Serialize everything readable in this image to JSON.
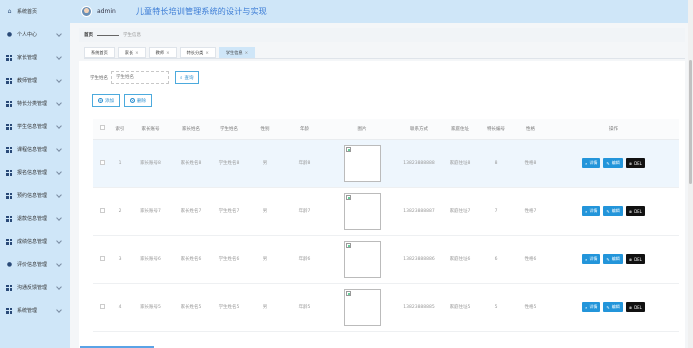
{
  "header": {
    "username": "admin",
    "app_title": "儿童特长培训管理系统的设计与实现"
  },
  "sidebar": {
    "items": [
      {
        "label": "系统首页",
        "icon": "home-icon"
      },
      {
        "label": "个人中心",
        "icon": "user-icon"
      },
      {
        "label": "家长管理",
        "icon": "grid-icon"
      },
      {
        "label": "教师管理",
        "icon": "grid-icon"
      },
      {
        "label": "特长分类管理",
        "icon": "grid-icon"
      },
      {
        "label": "学生信息管理",
        "icon": "grid-icon"
      },
      {
        "label": "课程信息管理",
        "icon": "grid-icon"
      },
      {
        "label": "报名信息管理",
        "icon": "grid-icon"
      },
      {
        "label": "预约信息管理",
        "icon": "grid-icon"
      },
      {
        "label": "退款信息管理",
        "icon": "grid-icon"
      },
      {
        "label": "成绩信息管理",
        "icon": "grid-icon"
      },
      {
        "label": "评价信息管理",
        "icon": "user-icon"
      },
      {
        "label": "沟通反馈管理",
        "icon": "grid-icon"
      },
      {
        "label": "系统管理",
        "icon": "grid-icon"
      }
    ]
  },
  "breadcrumb": {
    "home": "首页",
    "current": "学生信息"
  },
  "tabs": [
    {
      "label": "系统首页",
      "closable": false
    },
    {
      "label": "家长",
      "closable": true
    },
    {
      "label": "教师",
      "closable": true
    },
    {
      "label": "特长分类",
      "closable": true
    },
    {
      "label": "学生信息",
      "closable": true,
      "active": true
    }
  ],
  "search": {
    "label": "学生姓名",
    "placeholder": "学生姓名",
    "button": "查询"
  },
  "actions": {
    "add": "添加",
    "delete": "删除"
  },
  "table": {
    "columns": [
      "索引",
      "家长账号",
      "家长姓名",
      "学生姓名",
      "性别",
      "年龄",
      "图片",
      "联系方式",
      "家庭住址",
      "特长编号",
      "性格",
      "操作"
    ],
    "rows": [
      {
        "index": "1",
        "parent_account": "家长账号8",
        "parent_name": "家长姓名8",
        "student_name": "学生姓名8",
        "gender": "男",
        "age": "年龄8",
        "phone": "13823888888",
        "address": "家庭住址8",
        "talent_no": "8",
        "personality": "性格8"
      },
      {
        "index": "2",
        "parent_account": "家长账号7",
        "parent_name": "家长姓名7",
        "student_name": "学生姓名7",
        "gender": "男",
        "age": "年龄7",
        "phone": "13823888887",
        "address": "家庭住址7",
        "talent_no": "7",
        "personality": "性格7"
      },
      {
        "index": "3",
        "parent_account": "家长账号6",
        "parent_name": "家长姓名6",
        "student_name": "学生姓名6",
        "gender": "男",
        "age": "年龄6",
        "phone": "13823888886",
        "address": "家庭住址6",
        "talent_no": "6",
        "personality": "性格6"
      },
      {
        "index": "4",
        "parent_account": "家长账号5",
        "parent_name": "家长姓名5",
        "student_name": "学生姓名5",
        "gender": "男",
        "age": "年龄5",
        "phone": "13823888885",
        "address": "家庭住址5",
        "talent_no": "5",
        "personality": "性格5"
      }
    ],
    "buttons": {
      "detail": "详情",
      "edit": "编辑",
      "del": "DEL"
    }
  },
  "colors": {
    "sidebar_bg": "#cfe6f8",
    "accent": "#2395da",
    "title": "#3a7bd5",
    "del": "#111111"
  }
}
